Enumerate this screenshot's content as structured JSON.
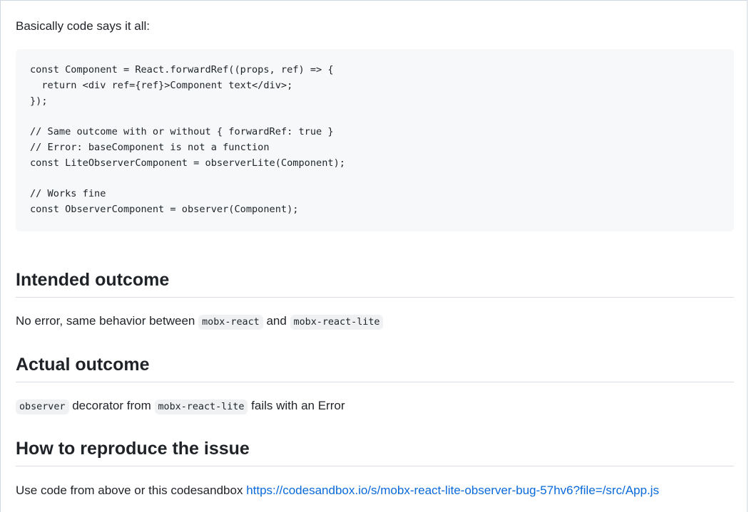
{
  "intro": "Basically code says it all:",
  "code_lines": [
    "const Component = React.forwardRef((props, ref) => {",
    "  return <div ref={ref}>Component text</div>;",
    "});",
    "",
    "// Same outcome with or without { forwardRef: true }",
    "// Error: baseComponent is not a function",
    "const LiteObserverComponent = observerLite(Component);",
    "",
    "// Works fine",
    "const ObserverComponent = observer(Component);"
  ],
  "intended": {
    "heading": "Intended outcome",
    "text_1": "No error, same behavior between ",
    "code_1": "mobx-react",
    "text_2": " and ",
    "code_2": "mobx-react-lite"
  },
  "actual": {
    "heading": "Actual outcome",
    "code_1": "observer",
    "text_1": " decorator from ",
    "code_2": "mobx-react-lite",
    "text_2": " fails with an Error"
  },
  "reproduce": {
    "heading": "How to reproduce the issue",
    "text": "Use code from above or this codesandbox ",
    "link": "https://codesandbox.io/s/mobx-react-lite-observer-bug-57hv6?file=/src/App.js"
  }
}
